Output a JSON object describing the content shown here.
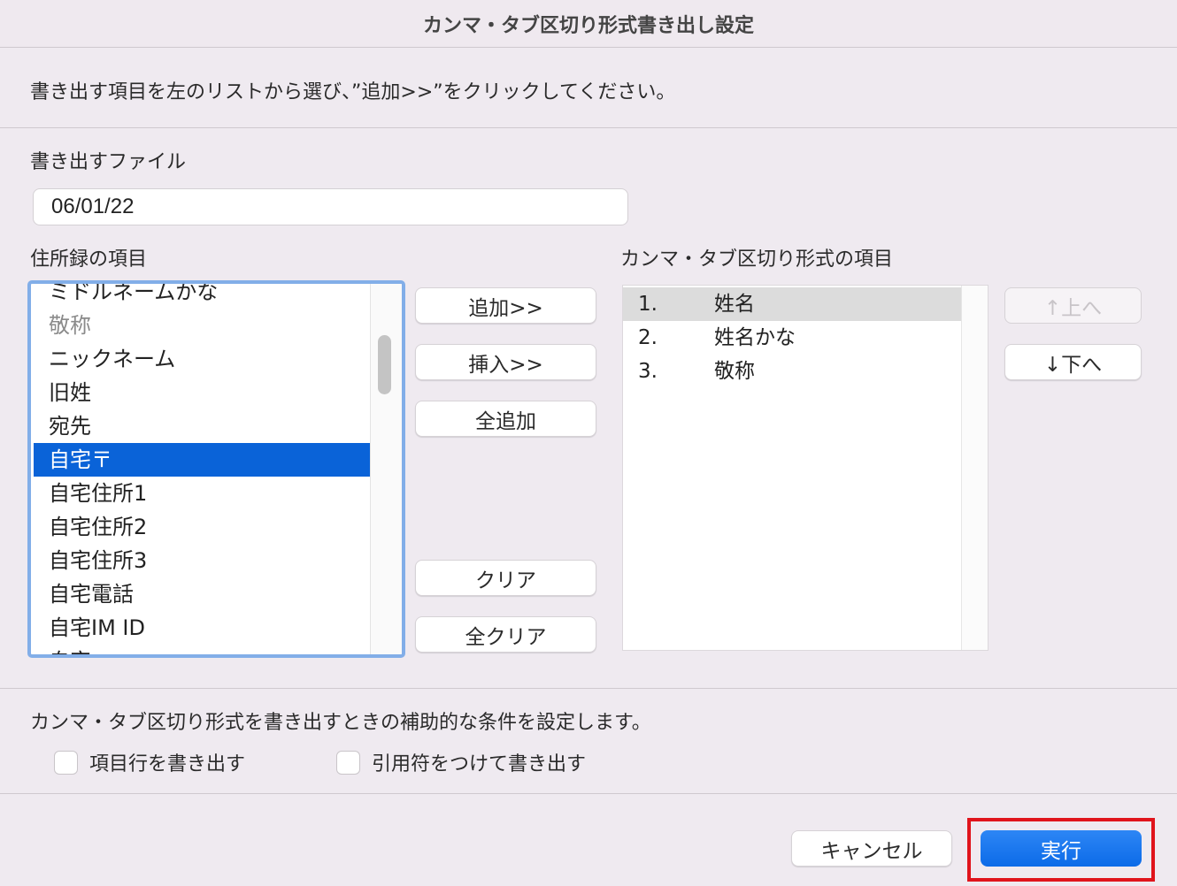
{
  "window": {
    "title": "カンマ・タブ区切り形式書き出し設定"
  },
  "instruction": "書き出す項目を左のリストから選び、”追加>>”をクリックしてください。",
  "export_file": {
    "label": "書き出すファイル",
    "value": "06/01/22"
  },
  "left_list": {
    "label": "住所録の項目",
    "items": [
      {
        "label": "ミドルネームかな",
        "state": "normal"
      },
      {
        "label": "敬称",
        "state": "dim"
      },
      {
        "label": "ニックネーム",
        "state": "normal"
      },
      {
        "label": "旧姓",
        "state": "normal"
      },
      {
        "label": "宛先",
        "state": "normal"
      },
      {
        "label": "自宅〒",
        "state": "selected"
      },
      {
        "label": "自宅住所1",
        "state": "normal"
      },
      {
        "label": "自宅住所2",
        "state": "normal"
      },
      {
        "label": "自宅住所3",
        "state": "normal"
      },
      {
        "label": "自宅電話",
        "state": "normal"
      },
      {
        "label": "自宅IM ID",
        "state": "normal"
      },
      {
        "label": "自宅...",
        "state": "normal"
      }
    ]
  },
  "middle_buttons": {
    "add": "追加>>",
    "insert": "挿入>>",
    "add_all": "全追加",
    "clear": "クリア",
    "clear_all": "全クリア"
  },
  "right_list": {
    "label": "カンマ・タブ区切り形式の項目",
    "rows": [
      {
        "num": "1.",
        "name": "姓名"
      },
      {
        "num": "2.",
        "name": "姓名かな"
      },
      {
        "num": "3.",
        "name": "敬称"
      }
    ]
  },
  "order_buttons": {
    "up": "↑上へ",
    "down": "↓下へ"
  },
  "options": {
    "description": "カンマ・タブ区切り形式を書き出すときの補助的な条件を設定します。",
    "header_row": "項目行を書き出す",
    "quote": "引用符をつけて書き出す"
  },
  "footer": {
    "cancel": "キャンセル",
    "execute": "実行"
  },
  "colors": {
    "accent": "#0a63d8",
    "highlight_border": "#e0141c"
  }
}
